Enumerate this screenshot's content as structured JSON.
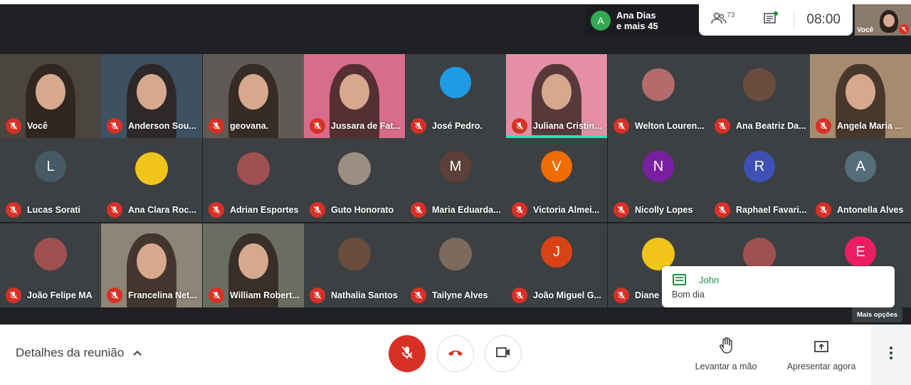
{
  "colors": {
    "accent_red": "#d93025",
    "meet_dark": "#202124",
    "chat_green": "#1e8e3e"
  },
  "top": {
    "presence_initial": "A",
    "presence_name": "Ana Dias",
    "presence_more": "e mais 45",
    "participants_count": "73",
    "clock": "08:00",
    "self_label": "Você"
  },
  "tiles": [
    {
      "name": "Você",
      "kind": "video"
    },
    {
      "name": "Anderson Sou...",
      "kind": "video"
    },
    {
      "name": "geovana.",
      "kind": "video"
    },
    {
      "name": "Jussara de Fat...",
      "kind": "video"
    },
    {
      "name": "José Pedro.",
      "kind": "avatar",
      "avatar_color": "#1e9be3"
    },
    {
      "name": "Juliana Cristin...",
      "kind": "video",
      "speaking": true
    },
    {
      "name": "Welton Louren...",
      "kind": "photo"
    },
    {
      "name": "Ana Beatriz Da...",
      "kind": "photo"
    },
    {
      "name": "Angela Maria ...",
      "kind": "video"
    },
    {
      "name": "Lucas Sorati",
      "kind": "avatar",
      "initial": "L",
      "avatar_color": "#455a64"
    },
    {
      "name": "Ana Clara Roc...",
      "kind": "photo"
    },
    {
      "name": "Adrian Esportes",
      "kind": "photo"
    },
    {
      "name": "Guto Honorato",
      "kind": "photo"
    },
    {
      "name": "Maria Eduarda...",
      "kind": "avatar",
      "initial": "M",
      "avatar_color": "#5d4037"
    },
    {
      "name": "Victoria Almei...",
      "kind": "avatar",
      "initial": "V",
      "avatar_color": "#ef6c00"
    },
    {
      "name": "Nicolly Lopes",
      "kind": "avatar",
      "initial": "N",
      "avatar_color": "#7b1fa2"
    },
    {
      "name": "Raphael Favari...",
      "kind": "avatar",
      "initial": "R",
      "avatar_color": "#3f51b5"
    },
    {
      "name": "Antonella Alves",
      "kind": "avatar",
      "initial": "A",
      "avatar_color": "#546e7a"
    },
    {
      "name": "João Felipe MA",
      "kind": "photo"
    },
    {
      "name": "Francelina Net...",
      "kind": "video"
    },
    {
      "name": "William Robert...",
      "kind": "video"
    },
    {
      "name": "Nathalia Santos",
      "kind": "photo"
    },
    {
      "name": "Tailyne Alves",
      "kind": "photo"
    },
    {
      "name": "João Miguel G...",
      "kind": "avatar",
      "initial": "J",
      "avatar_color": "#d84315"
    },
    {
      "name": "Diane",
      "kind": "photo"
    },
    {
      "name": "",
      "kind": "photo"
    },
    {
      "name": "",
      "kind": "avatar",
      "initial": "E",
      "avatar_color": "#e91e63"
    }
  ],
  "chat_popup": {
    "sender": "John",
    "message": "Bom dia"
  },
  "bottom": {
    "details_label": "Detalhes da reunião",
    "raise_hand_label": "Levantar a mão",
    "present_label": "Apresentar agora",
    "more_tooltip": "Mais opções"
  }
}
